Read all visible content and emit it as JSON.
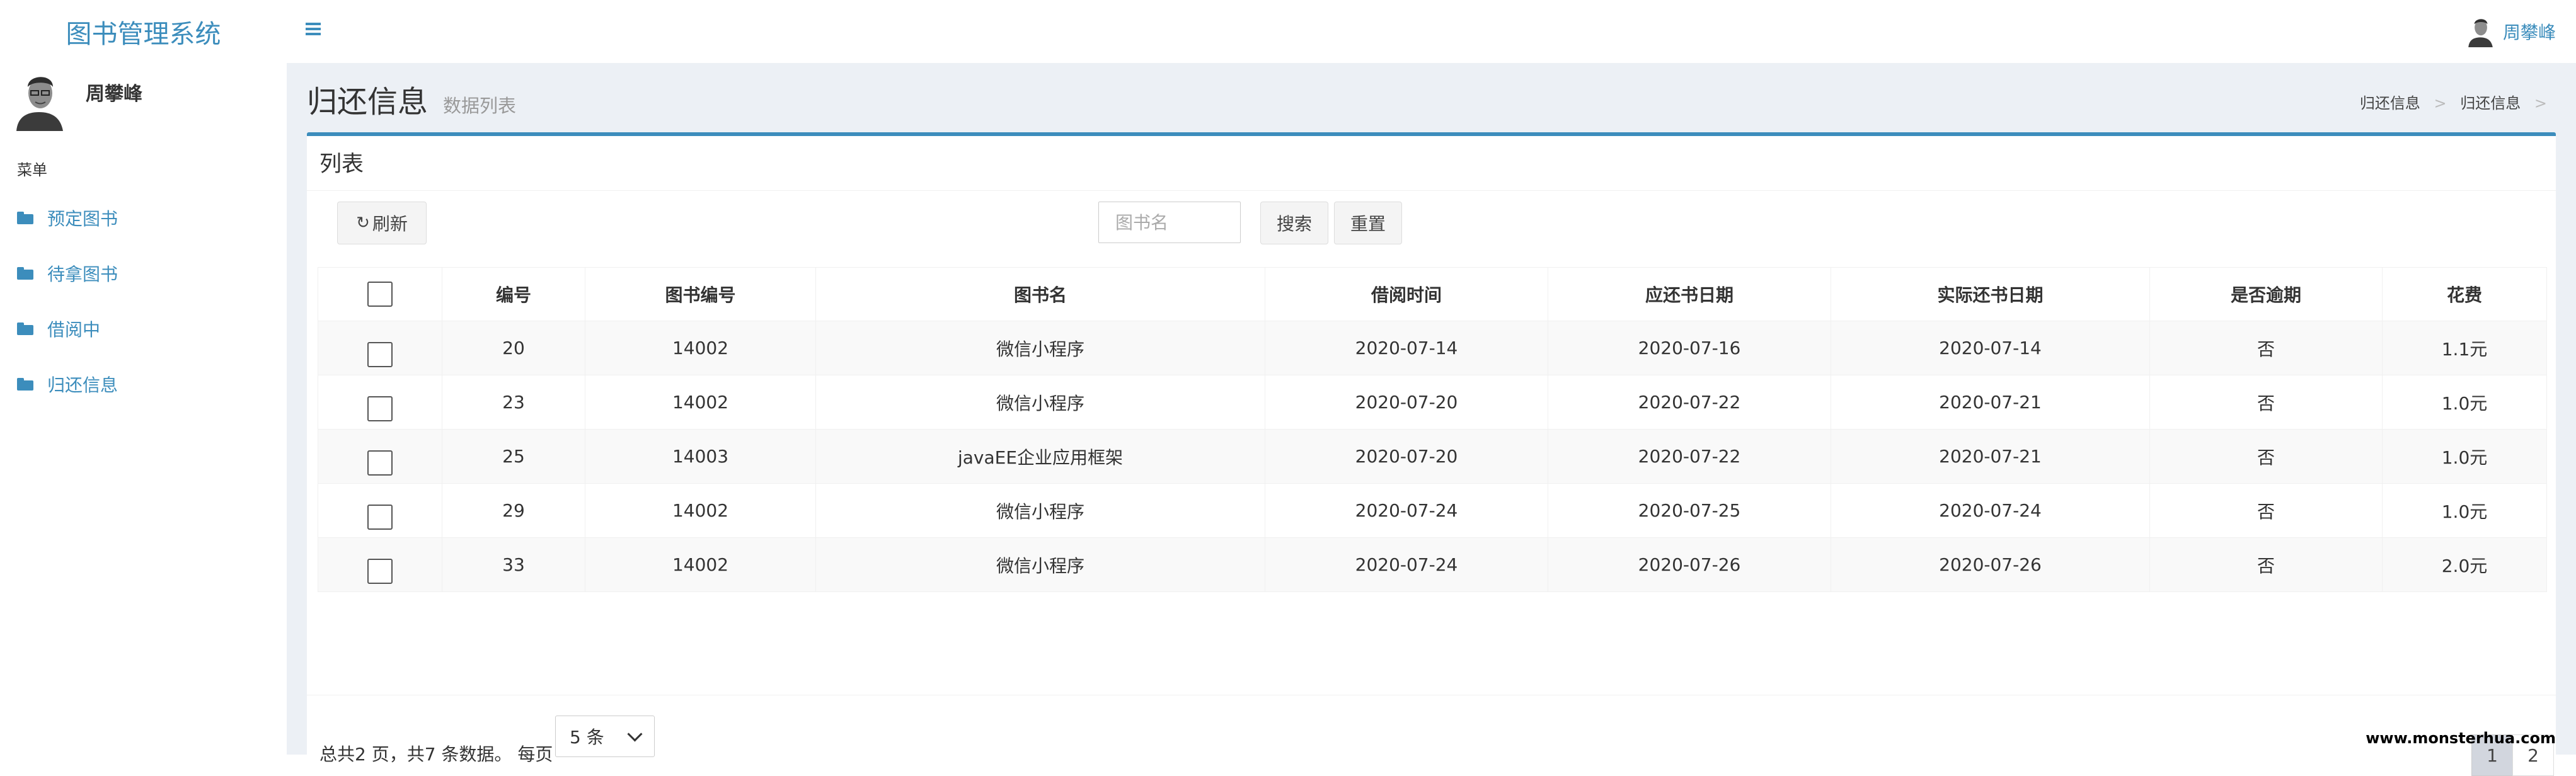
{
  "brand": {
    "title": "图书管理系统"
  },
  "sidebar": {
    "user_name": "周攀峰",
    "menu_header": "菜单",
    "items": [
      {
        "label": "预定图书",
        "icon": "folder-icon"
      },
      {
        "label": "待拿图书",
        "icon": "folder-icon"
      },
      {
        "label": "借阅中",
        "icon": "folder-icon"
      },
      {
        "label": "归还信息",
        "icon": "folder-icon"
      }
    ]
  },
  "topbar": {
    "user_name": "周攀峰",
    "menu_icon": "hamburger-icon"
  },
  "page": {
    "title": "归还信息",
    "subtitle": "数据列表",
    "breadcrumb": [
      "归还信息",
      "归还信息"
    ],
    "breadcrumb_sep": ">"
  },
  "box": {
    "title": "列表"
  },
  "toolbar": {
    "refresh_label": "刷新",
    "search_placeholder": "图书名",
    "search_label": "搜索",
    "reset_label": "重置"
  },
  "table": {
    "columns": [
      "编号",
      "图书编号",
      "图书名",
      "借阅时间",
      "应还书日期",
      "实际还书日期",
      "是否逾期",
      "花费"
    ],
    "rows": [
      [
        "20",
        "14002",
        "微信小程序",
        "2020-07-14",
        "2020-07-16",
        "2020-07-14",
        "否",
        "1.1元"
      ],
      [
        "23",
        "14002",
        "微信小程序",
        "2020-07-20",
        "2020-07-22",
        "2020-07-21",
        "否",
        "1.0元"
      ],
      [
        "25",
        "14003",
        "javaEE企业应用框架",
        "2020-07-20",
        "2020-07-22",
        "2020-07-21",
        "否",
        "1.0元"
      ],
      [
        "29",
        "14002",
        "微信小程序",
        "2020-07-24",
        "2020-07-25",
        "2020-07-24",
        "否",
        "1.0元"
      ],
      [
        "33",
        "14002",
        "微信小程序",
        "2020-07-24",
        "2020-07-26",
        "2020-07-26",
        "否",
        "2.0元"
      ]
    ]
  },
  "pagination": {
    "info": "总共2 页，共7 条数据。 每页",
    "page_size": "5 条",
    "pages": [
      "1",
      "2"
    ],
    "current_page": "1"
  },
  "watermark": "www.monsterhua.com",
  "colors": {
    "accent": "#3c8dbc",
    "content_bg": "#ecf0f5"
  }
}
